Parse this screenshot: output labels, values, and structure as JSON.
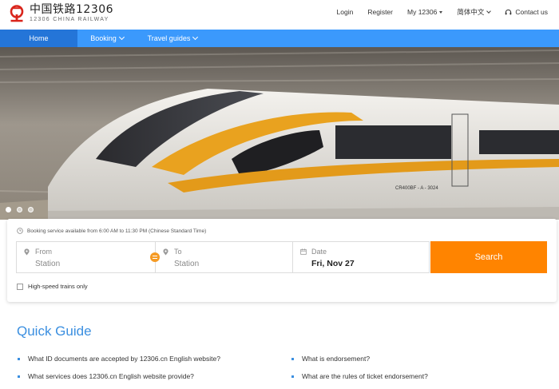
{
  "header": {
    "logo_cn": "中国铁路12306",
    "logo_en": "12306 CHINA RAILWAY",
    "links": [
      "Login",
      "Register",
      "My 12306",
      "简体中文",
      "Contact us"
    ]
  },
  "nav": {
    "items": [
      "Home",
      "Booking",
      "Travel guides"
    ],
    "active_color": "#2475d8",
    "bar_color": "#3b99fc"
  },
  "hero": {
    "train_number": "CR400BF - A - 3024",
    "slide_count": 3
  },
  "search": {
    "notice": "Booking service available from 6:00 AM to 11:30 PM (Chinese Standard Time)",
    "from_label": "From",
    "from_placeholder": "Station",
    "to_label": "To",
    "to_placeholder": "Station",
    "date_label": "Date",
    "date_value": "Fri, Nov 27",
    "button": "Search",
    "high_speed_label": "High-speed trains only",
    "button_color": "#ff8400"
  },
  "quick_guide": {
    "title": "Quick Guide",
    "left_items": [
      "What ID documents are accepted by 12306.cn English website?",
      "What services does 12306.cn English website provide?"
    ],
    "right_items": [
      "What is endorsement?",
      "What are the rules of ticket endorsement?"
    ]
  }
}
